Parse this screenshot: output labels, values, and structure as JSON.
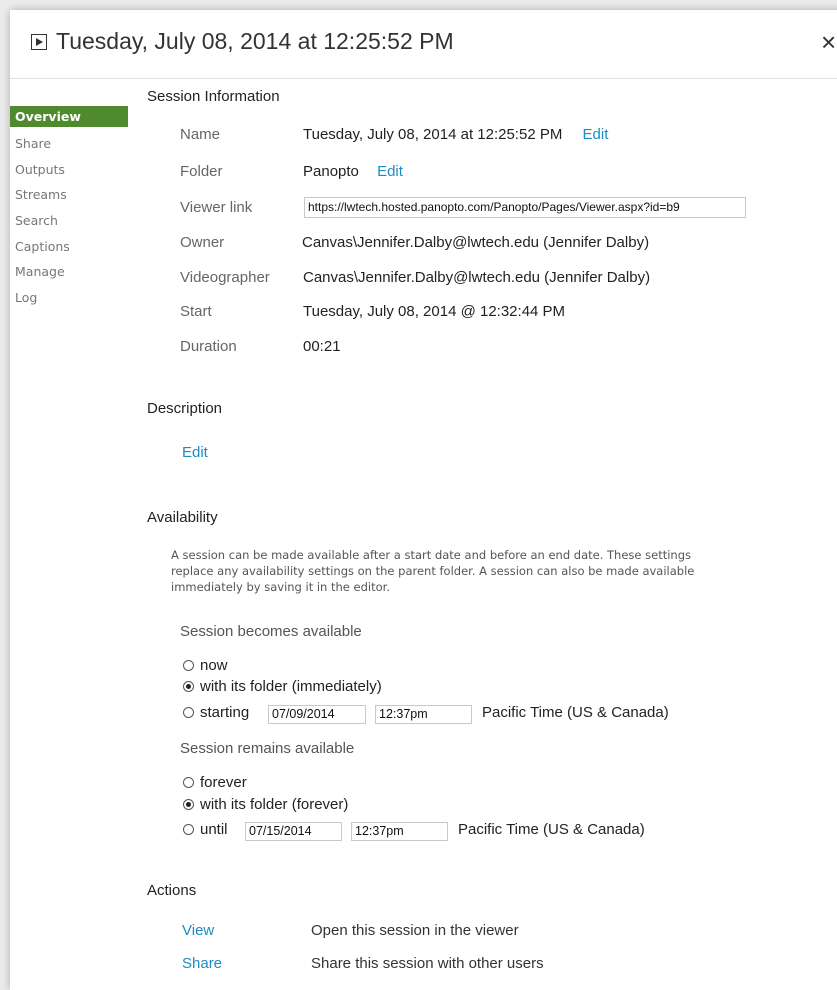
{
  "header": {
    "title": "Tuesday, July 08, 2014 at 12:25:52 PM",
    "close_symbol": "×"
  },
  "nav": {
    "items": [
      {
        "label": "Overview",
        "active": true
      },
      {
        "label": "Share"
      },
      {
        "label": "Outputs"
      },
      {
        "label": "Streams"
      },
      {
        "label": "Search"
      },
      {
        "label": "Captions"
      },
      {
        "label": "Manage"
      },
      {
        "label": "Log"
      }
    ]
  },
  "session_info": {
    "title": "Session Information",
    "name_label": "Name",
    "name_value": "Tuesday, July 08, 2014 at 12:25:52 PM",
    "name_edit": "Edit",
    "folder_label": "Folder",
    "folder_value": "Panopto",
    "folder_edit": "Edit",
    "viewer_link_label": "Viewer link",
    "viewer_link_value": "https://lwtech.hosted.panopto.com/Panopto/Pages/Viewer.aspx?id=b9",
    "owner_label": "Owner",
    "owner_value": "Canvas\\Jennifer.Dalby@lwtech.edu (Jennifer Dalby)",
    "videographer_label": "Videographer",
    "videographer_value": "Canvas\\Jennifer.Dalby@lwtech.edu (Jennifer Dalby)",
    "start_label": "Start",
    "start_value": "Tuesday, July 08, 2014 @ 12:32:44 PM",
    "duration_label": "Duration",
    "duration_value": "00:21"
  },
  "description": {
    "title": "Description",
    "edit": "Edit"
  },
  "availability": {
    "title": "Availability",
    "help_text": "A session can be made available after a start date and before an end date. These settings replace any availability settings on the parent folder. A session can also be made available immediately by saving it in the editor.",
    "becomes_label": "Session becomes available",
    "becomes_options": [
      "now",
      "with its folder (immediately)",
      "starting"
    ],
    "becomes_selected": 1,
    "start_date": "07/09/2014",
    "start_time": "12:37pm",
    "start_tz": "Pacific Time (US & Canada)",
    "remains_label": "Session remains available",
    "remains_options": [
      "forever",
      "with its folder (forever)",
      "until"
    ],
    "remains_selected": 1,
    "end_date": "07/15/2014",
    "end_time": "12:37pm",
    "end_tz": "Pacific Time (US & Canada)"
  },
  "actions": {
    "title": "Actions",
    "items": [
      {
        "label": "View",
        "desc": "Open this session in the viewer"
      },
      {
        "label": "Share",
        "desc": "Share this session with other users"
      }
    ]
  },
  "colors": {
    "accent_green": "#4f8b2e",
    "link_blue": "#1b8dc4"
  }
}
